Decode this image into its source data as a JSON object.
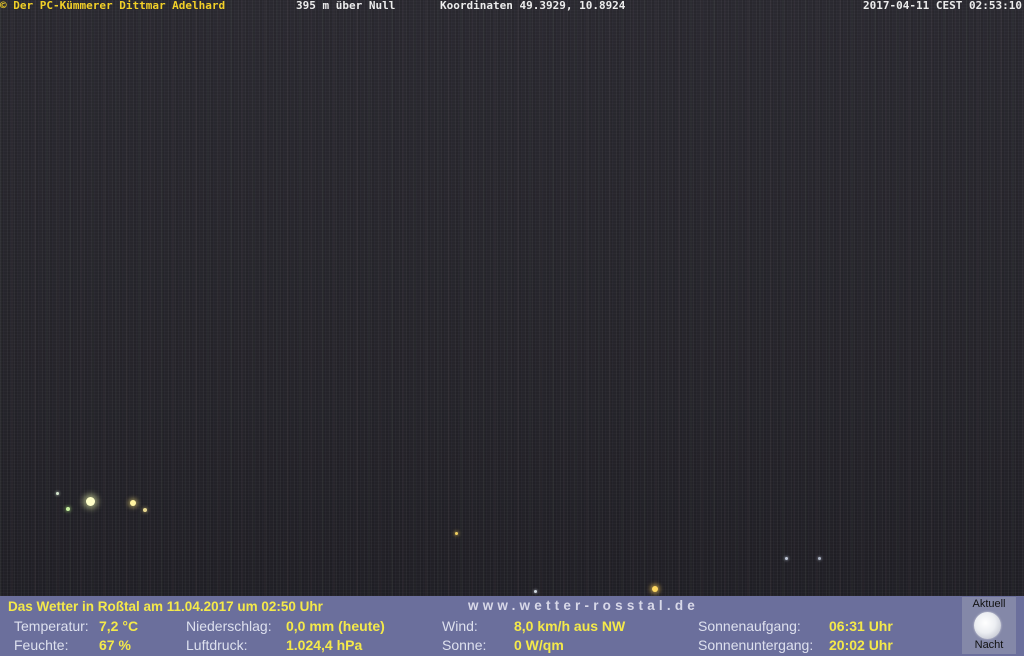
{
  "overlay": {
    "credit": "© Der PC-Kümmerer Dittmar Adelhard",
    "elevation": "395 m über Null",
    "coordinates": "Koordinaten 49.3929, 10.8924",
    "timestamp": "2017-04-11 CEST 02:53:10"
  },
  "weather": {
    "title": "Das Wetter in Roßtal am 11.04.2017 um 02:50 Uhr",
    "url": "www.wetter-rosstal.de",
    "temperature_label": "Temperatur:",
    "temperature_value": "7,2 °C",
    "humidity_label": "Feuchte:",
    "humidity_value": "67 %",
    "precip_label": "Niederschlag:",
    "precip_value": "0,0 mm (heute)",
    "pressure_label": "Luftdruck:",
    "pressure_value": "1.024,4 hPa",
    "wind_label": "Wind:",
    "wind_value": "8,0 km/h aus NW",
    "sun_label": "Sonne:",
    "sun_value": "0 W/qm",
    "sunrise_label": "Sonnenaufgang:",
    "sunrise_value": "06:31 Uhr",
    "sunset_label": "Sonnenuntergang:",
    "sunset_value": "20:02 Uhr"
  },
  "moon": {
    "top_label": "Aktuell",
    "bottom_label": "Nacht",
    "icon": "moon-icon"
  },
  "colors": {
    "credit": "#f2d027",
    "info_bar": "#6b6f9c",
    "value_text": "#f4e94a"
  }
}
